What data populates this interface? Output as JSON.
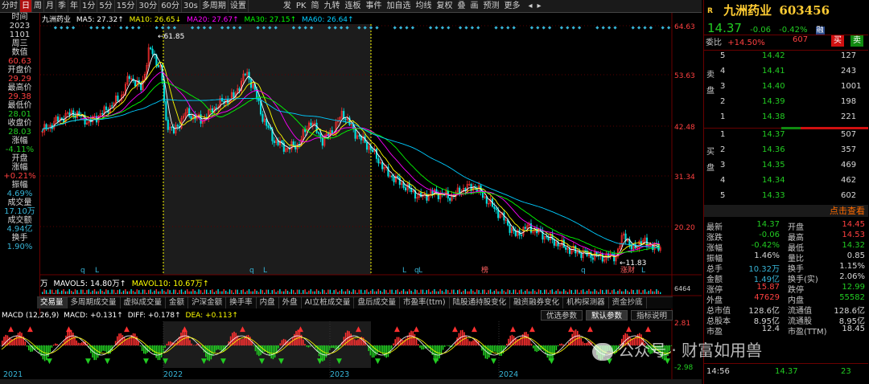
{
  "topbar": {
    "items": [
      "分时",
      "日",
      "周",
      "月",
      "季",
      "年",
      "1分",
      "5分",
      "15分",
      "30分",
      "60分",
      "30s",
      "多周期",
      "设置"
    ],
    "selected_index": 1,
    "right": [
      "发",
      "PK",
      "简",
      "九转",
      "连板",
      "事件",
      "加自选",
      "均线",
      "复权",
      "叠",
      "画",
      "预测",
      "更多"
    ]
  },
  "left_panel": [
    {
      "t": "时间",
      "c": "w"
    },
    {
      "t": "2023",
      "c": "w"
    },
    {
      "t": "1101",
      "c": "w"
    },
    {
      "t": "周三",
      "c": "w"
    },
    {
      "t": "数值",
      "c": "w"
    },
    {
      "t": "60.63",
      "c": "red"
    },
    {
      "t": "开盘价",
      "c": "w"
    },
    {
      "t": "29.29",
      "c": "red"
    },
    {
      "t": "最高价",
      "c": "w"
    },
    {
      "t": "29.38",
      "c": "red"
    },
    {
      "t": "最低价",
      "c": "w"
    },
    {
      "t": "28.01",
      "c": "grn"
    },
    {
      "t": "收盘价",
      "c": "w"
    },
    {
      "t": "28.03",
      "c": "grn"
    },
    {
      "t": "涨幅",
      "c": "w"
    },
    {
      "t": "-4.11%",
      "c": "grn"
    },
    {
      "t": "开盘",
      "c": "w"
    },
    {
      "t": "涨幅",
      "c": "w"
    },
    {
      "t": "+0.21%",
      "c": "red"
    },
    {
      "t": "振幅",
      "c": "w"
    },
    {
      "t": "4.69%",
      "c": "cy"
    },
    {
      "t": "成交量",
      "c": "w"
    },
    {
      "t": "17.10万",
      "c": "cy"
    },
    {
      "t": "成交额",
      "c": "w"
    },
    {
      "t": "4.94亿",
      "c": "cy"
    },
    {
      "t": "换手",
      "c": "w"
    },
    {
      "t": "1.90%",
      "c": "cy"
    }
  ],
  "legend": {
    "stock": "九洲药业",
    "ma5": "MA5: 27.32↑",
    "ma10": "MA10: 26.65↓",
    "ma20": "MA20: 27.67↑",
    "ma30": "MA30: 27.15↑",
    "ma60": "MA60: 26.64↑"
  },
  "colors": {
    "ma5": "#ffffff",
    "ma10": "#ffff00",
    "ma20": "#ff00ff",
    "ma30": "#00ff00",
    "ma60": "#00ccff",
    "up": "#ff3030",
    "down": "#00e0e0"
  },
  "price_axis": [
    "64.63",
    "53.63",
    "42.48",
    "31.34",
    "20.20"
  ],
  "annotations": {
    "high": "61.85",
    "low": "11.83",
    "event1": "榜",
    "event2": "涨财"
  },
  "volume": {
    "label": "万",
    "mavol5": "MAVOL5: 14.80万↑",
    "mavol10": "MAVOL10: 10.67万↑",
    "axis": "6464"
  },
  "ind_tabs": [
    "交易量",
    "多周期成交量",
    "虚拟成交量",
    "金额",
    "沪深金额",
    "换手率",
    "内盘",
    "外盘",
    "AI立桩成交量",
    "盘后成交量",
    "市盈率(ttm)",
    "陆股通持股变化",
    "融资融券变化",
    "机构探测器",
    "资金抄底"
  ],
  "ind_tab_active": 0,
  "param_tabs": [
    "优选参数",
    "默认参数",
    "指标说明"
  ],
  "param_tab_active": 1,
  "macd": {
    "name": "MACD (12,26,9)",
    "macd": "MACD: +0.131↑",
    "diff": "DIFF: +0.178↑",
    "dea": "DEA: +0.113↑",
    "axis_top": "2.81",
    "axis_bot": "-2.98"
  },
  "years": [
    "2021",
    "2022",
    "2023",
    "2024"
  ],
  "right_panel": {
    "r_label": "R",
    "name": "九洲药业",
    "code": "603456",
    "price": "14.37",
    "change": "-0.06",
    "pct": "-0.42%",
    "tag": "融",
    "webi_label": "委比",
    "webi": "+14.50%",
    "wecha": "607",
    "buy_btn": "买",
    "sell_btn": "卖",
    "sell_side": "卖盘",
    "buy_side": "买盘",
    "sells": [
      {
        "n": "5",
        "p": "14.42",
        "v": "127"
      },
      {
        "n": "4",
        "p": "14.41",
        "v": "243"
      },
      {
        "n": "3",
        "p": "14.40",
        "v": "1001"
      },
      {
        "n": "2",
        "p": "14.39",
        "v": "198"
      },
      {
        "n": "1",
        "p": "14.38",
        "v": "221"
      }
    ],
    "buys": [
      {
        "n": "1",
        "p": "14.37",
        "v": "507"
      },
      {
        "n": "2",
        "p": "14.36",
        "v": "357"
      },
      {
        "n": "3",
        "p": "14.35",
        "v": "469"
      },
      {
        "n": "4",
        "p": "14.34",
        "v": "462"
      },
      {
        "n": "5",
        "p": "14.33",
        "v": "602"
      }
    ],
    "click": "点击查看",
    "stats": [
      {
        "a": "最新",
        "av": "14.37",
        "ac": "grn",
        "b": "开盘",
        "bv": "14.45",
        "bc": "red"
      },
      {
        "a": "涨跌",
        "av": "-0.06",
        "ac": "grn",
        "b": "最高",
        "bv": "14.53",
        "bc": "red"
      },
      {
        "a": "涨幅",
        "av": "-0.42%",
        "ac": "grn",
        "b": "最低",
        "bv": "14.32",
        "bc": "grn"
      },
      {
        "a": "振幅",
        "av": "1.46%",
        "ac": "w",
        "b": "量比",
        "bv": "0.85",
        "bc": "w"
      },
      {
        "a": "总手",
        "av": "10.32万",
        "ac": "cy",
        "b": "换手",
        "bv": "1.15%",
        "bc": "w"
      },
      {
        "a": "金额",
        "av": "1.49亿",
        "ac": "cy",
        "b": "换手(实)",
        "bv": "2.06%",
        "bc": "w"
      },
      {
        "a": "涨停",
        "av": "15.87",
        "ac": "red",
        "b": "跌停",
        "bv": "12.99",
        "bc": "grn"
      },
      {
        "a": "外盘",
        "av": "47629",
        "ac": "red",
        "b": "内盘",
        "bv": "55582",
        "bc": "grn"
      },
      {
        "a": "总市值",
        "av": "128.6亿",
        "ac": "w",
        "b": "流通值",
        "bv": "128.6亿",
        "bc": "w"
      },
      {
        "a": "总股本",
        "av": "8.95亿",
        "ac": "w",
        "b": "流通股",
        "bv": "8.95亿",
        "bc": "w"
      },
      {
        "a": "市盈",
        "av": "12.4",
        "ac": "w",
        "b": "市盈(TTM)",
        "bv": "18.45",
        "bc": "w"
      }
    ],
    "tick": {
      "time": "14:56",
      "price": "14.37",
      "vol": "23"
    }
  },
  "watermark": "公众号 · 财富如用兽"
}
